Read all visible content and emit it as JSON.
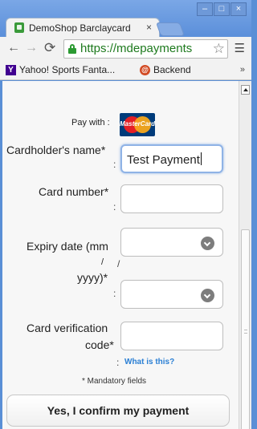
{
  "browser": {
    "tab_title": "DemoShop Barclaycard",
    "tab_close": "×",
    "window_controls": {
      "minimize": "–",
      "maximize": "□",
      "close": "×"
    },
    "url": "https://mdepayments",
    "bookmarks": [
      {
        "label": "Yahoo! Sports Fanta...",
        "icon": "Y"
      },
      {
        "label": "Backend",
        "icon": "@"
      }
    ],
    "bookmarks_more": "»"
  },
  "form": {
    "pay_with_label": "Pay with :",
    "card_brand": "MasterCard",
    "cardholder_label": "Cardholder's name*",
    "cardholder_value": "Test Payment",
    "card_number_label": "Card number*",
    "card_number_value": "",
    "expiry_label_line1": "Expiry date (mm",
    "expiry_label_line2": "/",
    "expiry_label_line3": "yyyy)*",
    "expiry_separator": "/",
    "cvc_label_line1": "Card verification",
    "cvc_label_line2": "code*",
    "colon": ":",
    "what_is_this": "What is this?",
    "mandatory_note": "* Mandatory fields",
    "confirm_button": "Yes, I confirm my payment"
  },
  "colors": {
    "title_bar": "#5b8fda",
    "secure_url": "#1e7a1e",
    "link": "#2a7fd4"
  }
}
